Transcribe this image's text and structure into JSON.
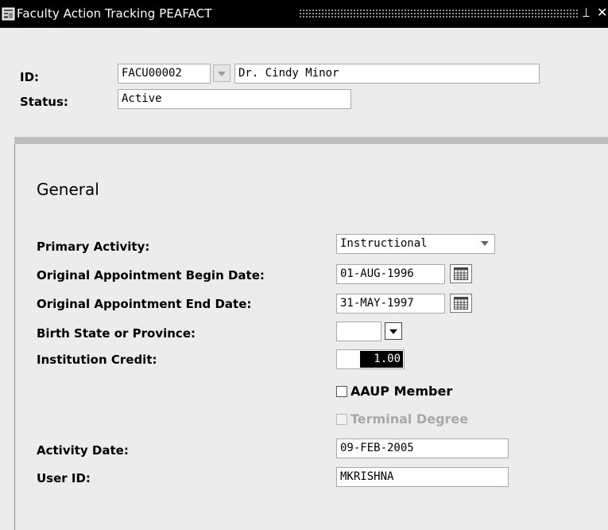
{
  "window": {
    "title": "Faculty Action Tracking  PEAFACT",
    "minimize_glyph": "⟘",
    "close_glyph": "✕"
  },
  "header": {
    "id_label": "ID:",
    "id_value": "FACU00002",
    "name_value": "Dr. Cindy Minor",
    "status_label": "Status:",
    "status_value": "Active"
  },
  "general": {
    "section_title": "General",
    "primary_activity_label": "Primary Activity:",
    "primary_activity_value": "Instructional",
    "begin_date_label": "Original Appointment Begin Date:",
    "begin_date_value": "01-AUG-1996",
    "end_date_label": "Original Appointment End Date:",
    "end_date_value": "31-MAY-1997",
    "birth_state_label": "Birth State or Province:",
    "birth_state_value": "",
    "institution_credit_label": "Institution Credit:",
    "institution_credit_value": "1.00",
    "aaup_label": "AAUP Member",
    "aaup_checked": false,
    "terminal_degree_label": "Terminal Degree",
    "terminal_degree_checked": false,
    "terminal_degree_enabled": false,
    "activity_date_label": "Activity Date:",
    "activity_date_value": "09-FEB-2005",
    "user_id_label": "User ID:",
    "user_id_value": "MKRISHNA"
  },
  "icons": {
    "app": "form-icon",
    "lookup": "dropdown-triangle-icon",
    "calendar": "calendar-icon"
  }
}
